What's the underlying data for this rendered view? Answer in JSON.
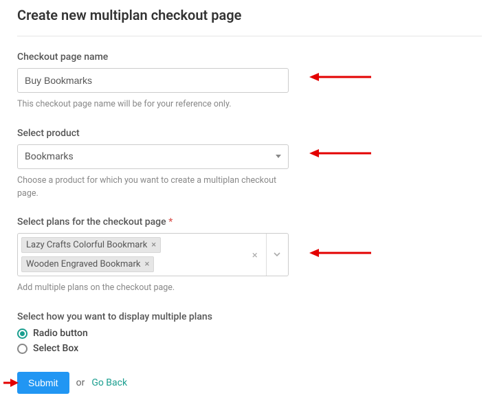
{
  "title": "Create new multiplan checkout page",
  "fields": {
    "name": {
      "label": "Checkout page name",
      "value": "Buy Bookmarks",
      "help": "This checkout page name will be for your reference only."
    },
    "product": {
      "label": "Select product",
      "value": "Bookmarks",
      "help": "Choose a product for which you want to create a multiplan checkout page."
    },
    "plans": {
      "label": "Select plans for the checkout page",
      "required_mark": "*",
      "selected": [
        "Lazy Crafts Colorful Bookmark",
        "Wooden Engraved Bookmark"
      ],
      "help": "Add multiple plans on the checkout page."
    },
    "display": {
      "label": "Select how you want to display multiple plans",
      "options": [
        "Radio button",
        "Select Box"
      ],
      "selected": "Radio button"
    }
  },
  "actions": {
    "submit": "Submit",
    "or": "or",
    "goback": "Go Back"
  }
}
